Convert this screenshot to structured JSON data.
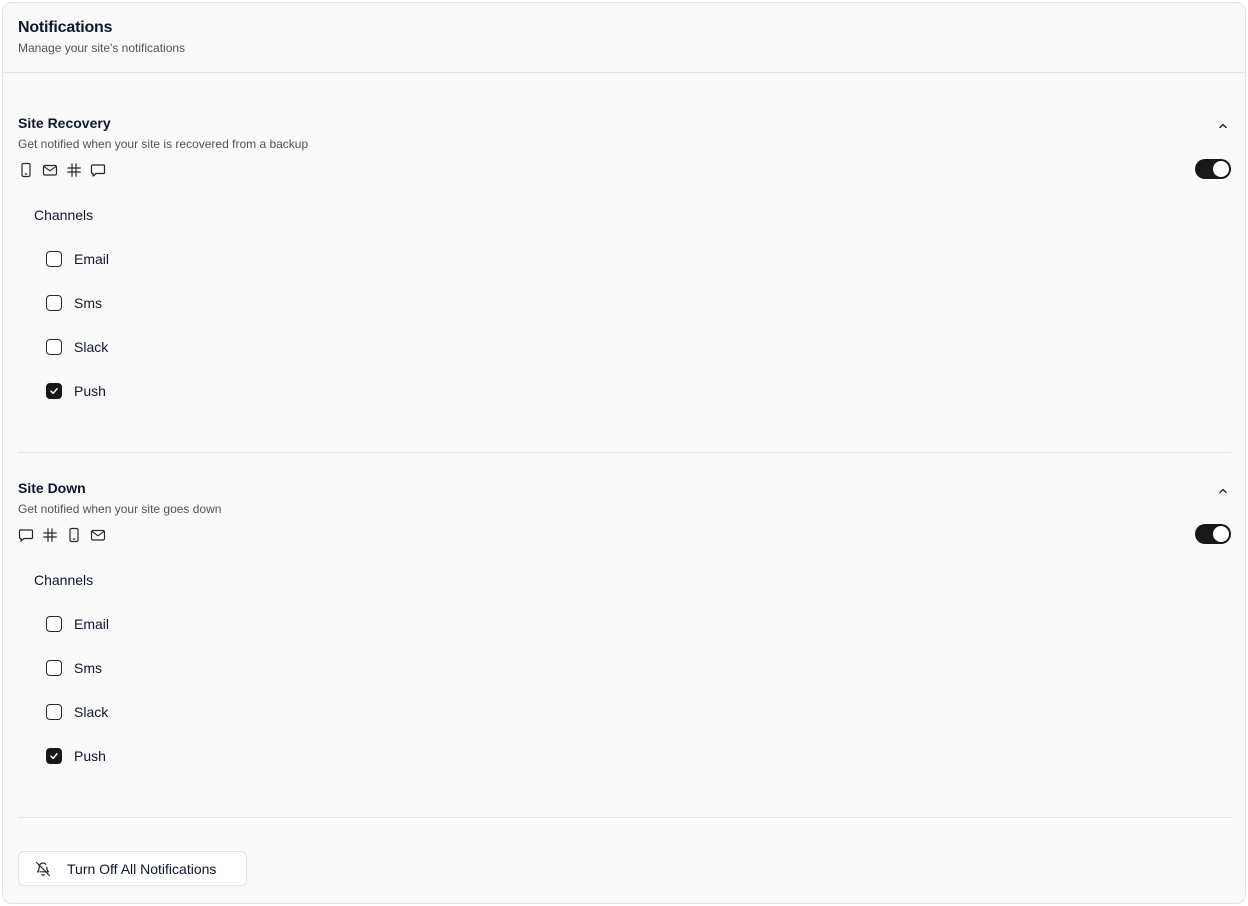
{
  "header": {
    "title": "Notifications",
    "subtitle": "Manage your site's notifications"
  },
  "sections": [
    {
      "title": "Site Recovery",
      "description": "Get notified when your site is recovered from a backup",
      "channel_icons": [
        "phone-icon",
        "mail-icon",
        "slack-icon",
        "message-icon"
      ],
      "enabled": true,
      "channels_label": "Channels",
      "options": [
        {
          "label": "Email",
          "checked": false
        },
        {
          "label": "Sms",
          "checked": false
        },
        {
          "label": "Slack",
          "checked": false
        },
        {
          "label": "Push",
          "checked": true
        }
      ]
    },
    {
      "title": "Site Down",
      "description": "Get notified when your site goes down",
      "channel_icons": [
        "message-icon",
        "slack-icon",
        "phone-icon",
        "mail-icon"
      ],
      "enabled": true,
      "channels_label": "Channels",
      "options": [
        {
          "label": "Email",
          "checked": false
        },
        {
          "label": "Sms",
          "checked": false
        },
        {
          "label": "Slack",
          "checked": false
        },
        {
          "label": "Push",
          "checked": true
        }
      ]
    }
  ],
  "footer": {
    "turn_off_label": "Turn Off All Notifications",
    "turn_off_icon": "bell-off-icon"
  },
  "colors": {
    "accent": "#18181b",
    "border": "#e4e4e7",
    "muted_text": "#52525b",
    "background": "#fafafa"
  }
}
